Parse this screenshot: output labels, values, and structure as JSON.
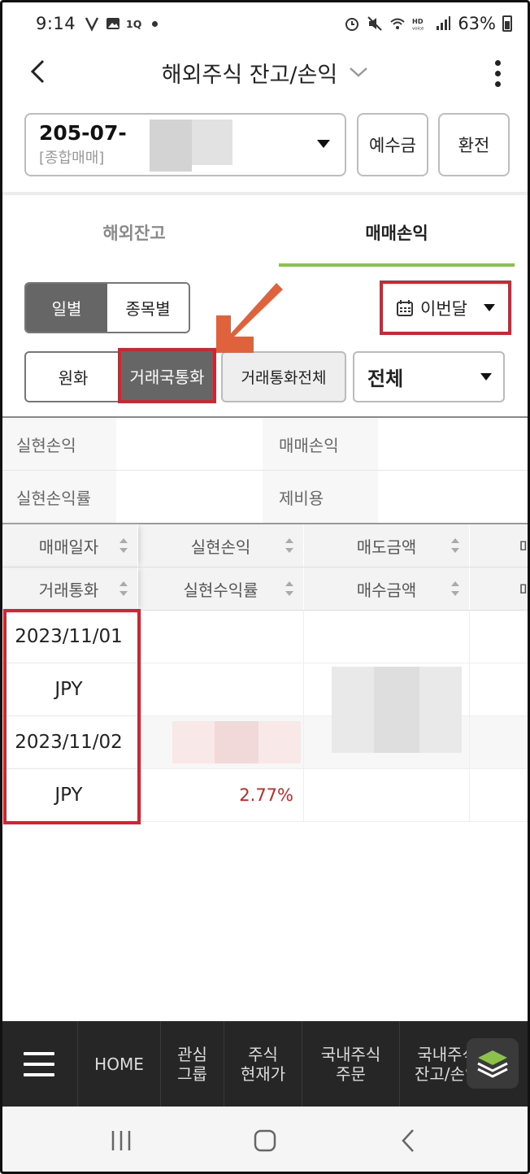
{
  "status_bar": {
    "time": "9:14",
    "battery": "63%"
  },
  "header": {
    "title": "해외주식 잔고/손익"
  },
  "account": {
    "number": "205-07-",
    "type": "[종합매매]"
  },
  "buttons": {
    "deposit": "예수금",
    "exchange": "환전"
  },
  "tabs": [
    {
      "label": "해외잔고",
      "active": false
    },
    {
      "label": "매매손익",
      "active": true
    }
  ],
  "view_toggle": {
    "daily": "일별",
    "by_stock": "종목별"
  },
  "period": {
    "label": "이번달"
  },
  "currency": {
    "won": "원화",
    "trade_country": "거래국통화",
    "all_trade": "거래통화전체"
  },
  "filter": {
    "value": "전체"
  },
  "summary": {
    "realized_pl": "실현손익",
    "trade_pl": "매매손익",
    "realized_rate": "실현손익률",
    "fees": "제비용"
  },
  "table": {
    "headers_row1": [
      "매매일자",
      "실현손익",
      "매도금액",
      "매"
    ],
    "headers_row2": [
      "거래통화",
      "실현수익률",
      "매수금액",
      "매"
    ],
    "rows": [
      {
        "date": "2023/11/01",
        "currency": "JPY",
        "realized_rate": ""
      },
      {
        "date": "2023/11/02",
        "currency": "JPY",
        "realized_rate": "2.77%"
      }
    ]
  },
  "bottom_nav": {
    "items": [
      "HOME",
      "관심\n그룹",
      "주식\n현재가",
      "국내주식\n주문",
      "국내주식\n잔고/손익"
    ]
  },
  "colors": {
    "highlight": "#d42331",
    "arrow": "#e0623c",
    "tab_underline": "#8bc34a",
    "loss_red": "#c62828"
  }
}
